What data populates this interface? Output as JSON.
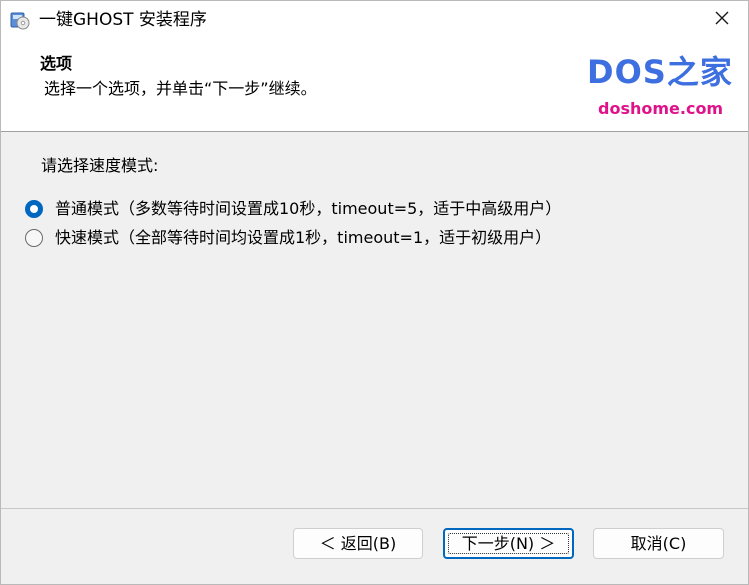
{
  "window": {
    "title": "一键GHOST 安装程序",
    "icon": "installer-disc-icon",
    "close_icon": "close-icon"
  },
  "header": {
    "title": "选项",
    "subtitle": "选择一个选项，并单击“下一步”继续。",
    "logo_main": "DOS之家",
    "logo_sub": "doshome.com"
  },
  "content": {
    "prompt": "请选择速度模式:",
    "options": [
      {
        "label": "普通模式（多数等待时间设置成10秒，timeout=5，适于中高级用户）",
        "selected": true
      },
      {
        "label": "快速模式（全部等待时间均设置成1秒，timeout=1，适于初级用户）",
        "selected": false
      }
    ]
  },
  "buttons": {
    "back": "＜ 返回(B)",
    "next": "下一步(N) ＞",
    "cancel": "取消(C)"
  },
  "colors": {
    "accent": "#0067c0",
    "logo_blue": "#3d6fe0",
    "logo_pink": "#e0128a"
  }
}
